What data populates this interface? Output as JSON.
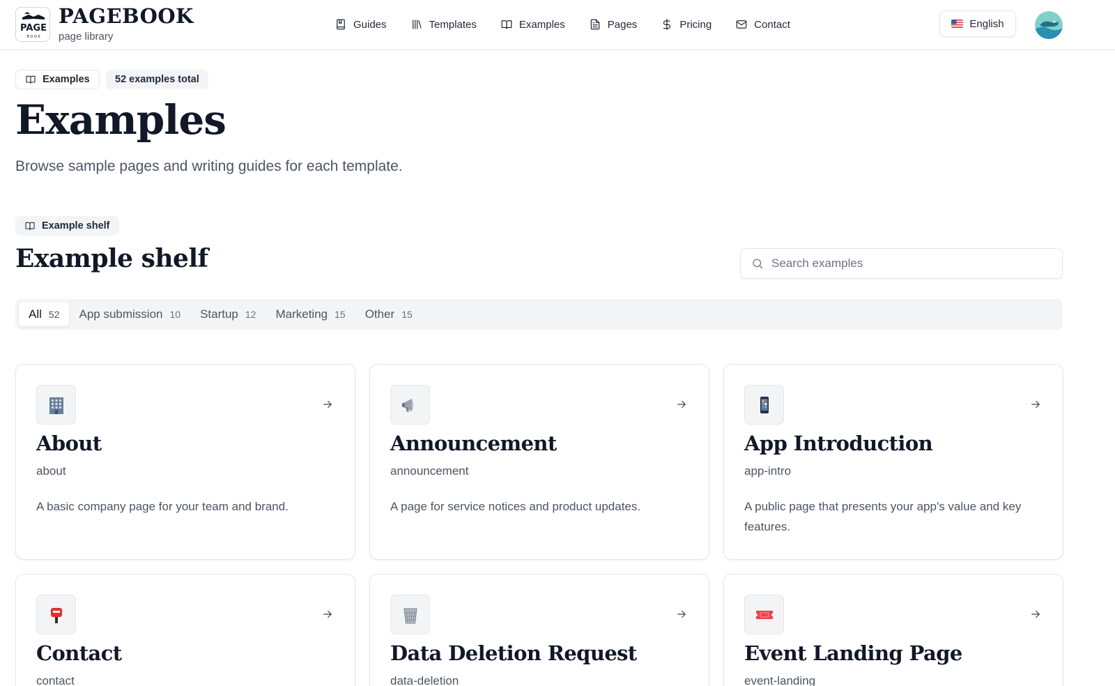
{
  "brand": {
    "name": "PAGEBOOK",
    "subtitle": "page library",
    "logo_text": "PAGE",
    "logo_small": "B O O K"
  },
  "nav": [
    {
      "label": "Guides",
      "icon": "bookmark-book-icon"
    },
    {
      "label": "Templates",
      "icon": "library-icon"
    },
    {
      "label": "Examples",
      "icon": "open-book-icon"
    },
    {
      "label": "Pages",
      "icon": "file-text-icon"
    },
    {
      "label": "Pricing",
      "icon": "dollar-icon"
    },
    {
      "label": "Contact",
      "icon": "mail-icon"
    }
  ],
  "language": {
    "label": "English",
    "flag": "us-flag-icon"
  },
  "header_chips": {
    "section": "Examples",
    "total": "52 examples total"
  },
  "page": {
    "title": "Examples",
    "description": "Browse sample pages and writing guides for each template."
  },
  "shelf": {
    "chip": "Example shelf",
    "title": "Example shelf",
    "search_placeholder": "Search examples"
  },
  "tabs": [
    {
      "label": "All",
      "count": "52",
      "active": true
    },
    {
      "label": "App submission",
      "count": "10",
      "active": false
    },
    {
      "label": "Startup",
      "count": "12",
      "active": false
    },
    {
      "label": "Marketing",
      "count": "15",
      "active": false
    },
    {
      "label": "Other",
      "count": "15",
      "active": false
    }
  ],
  "cards": [
    {
      "title": "About",
      "slug": "about",
      "description": "A basic company page for your team and brand.",
      "icon": "office-building-icon"
    },
    {
      "title": "Announcement",
      "slug": "announcement",
      "description": "A page for service notices and product updates.",
      "icon": "megaphone-icon"
    },
    {
      "title": "App Introduction",
      "slug": "app-intro",
      "description": "A public page that presents your app's value and key features.",
      "icon": "mobile-phone-icon"
    },
    {
      "title": "Contact",
      "slug": "contact",
      "description": "",
      "icon": "postbox-icon"
    },
    {
      "title": "Data Deletion Request",
      "slug": "data-deletion",
      "description": "",
      "icon": "wastebasket-icon"
    },
    {
      "title": "Event Landing Page",
      "slug": "event-landing",
      "description": "",
      "icon": "ticket-icon"
    }
  ],
  "colors": {
    "text": "#111827",
    "muted": "#4b5563",
    "border": "#e5e7eb",
    "surface": "#f3f4f6"
  }
}
